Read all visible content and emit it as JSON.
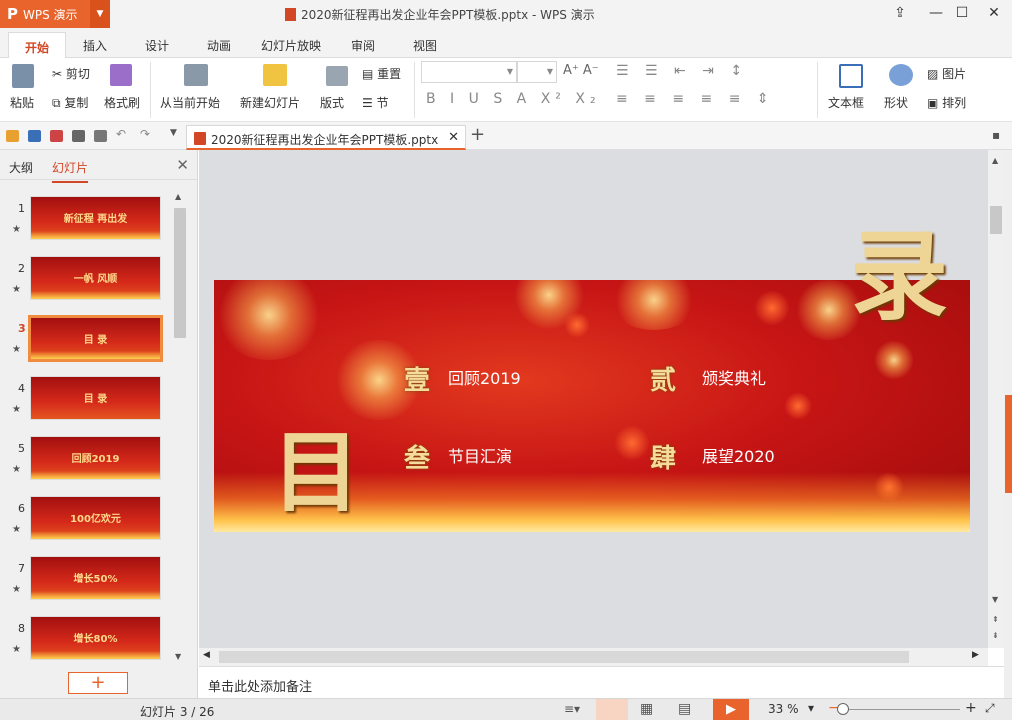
{
  "window": {
    "app_label": "WPS 演示",
    "title": "2020新征程再出发企业年会PPT模板.pptx - WPS 演示"
  },
  "menu_tabs": [
    "开始",
    "插入",
    "设计",
    "动画",
    "幻灯片放映",
    "审阅",
    "视图"
  ],
  "ribbon": {
    "paste": "粘贴",
    "cut": "剪切",
    "copy": "复制",
    "format_painter": "格式刷",
    "from_current": "从当前开始",
    "new_slide": "新建幻灯片",
    "layout": "版式",
    "reset": "重置",
    "section": "节",
    "textbox": "文本框",
    "shape": "形状",
    "picture": "图片",
    "arrange": "排列"
  },
  "doc_tab": {
    "name": "2020新征程再出发企业年会PPT模板.pptx"
  },
  "side_panel": {
    "tab_outline": "大纲",
    "tab_slides": "幻灯片"
  },
  "thumbnails": [
    {
      "num": "1",
      "text": "新征程 再出发"
    },
    {
      "num": "2",
      "text": "一帆 风顺"
    },
    {
      "num": "3",
      "text": "目 录"
    },
    {
      "num": "4",
      "text": "目 录"
    },
    {
      "num": "5",
      "text": "回顾2019"
    },
    {
      "num": "6",
      "text": "100亿欢元"
    },
    {
      "num": "7",
      "text": "增长50%"
    },
    {
      "num": "8",
      "text": "增长80%"
    }
  ],
  "slide": {
    "items": [
      {
        "num": "壹",
        "label": "回顾2019"
      },
      {
        "num": "贰",
        "label": "颁奖典礼"
      },
      {
        "num": "叁",
        "label": "节目汇演"
      },
      {
        "num": "肆",
        "label": "展望2020"
      }
    ],
    "char_left": "目",
    "char_right": "录"
  },
  "notes_placeholder": "单击此处添加备注",
  "status": {
    "slide_counter": "幻灯片 3 / 26",
    "zoom": "33 %"
  },
  "colors": {
    "accent": "#e8642c",
    "slide_red": "#c71515",
    "gold": "#f5dc9c"
  }
}
